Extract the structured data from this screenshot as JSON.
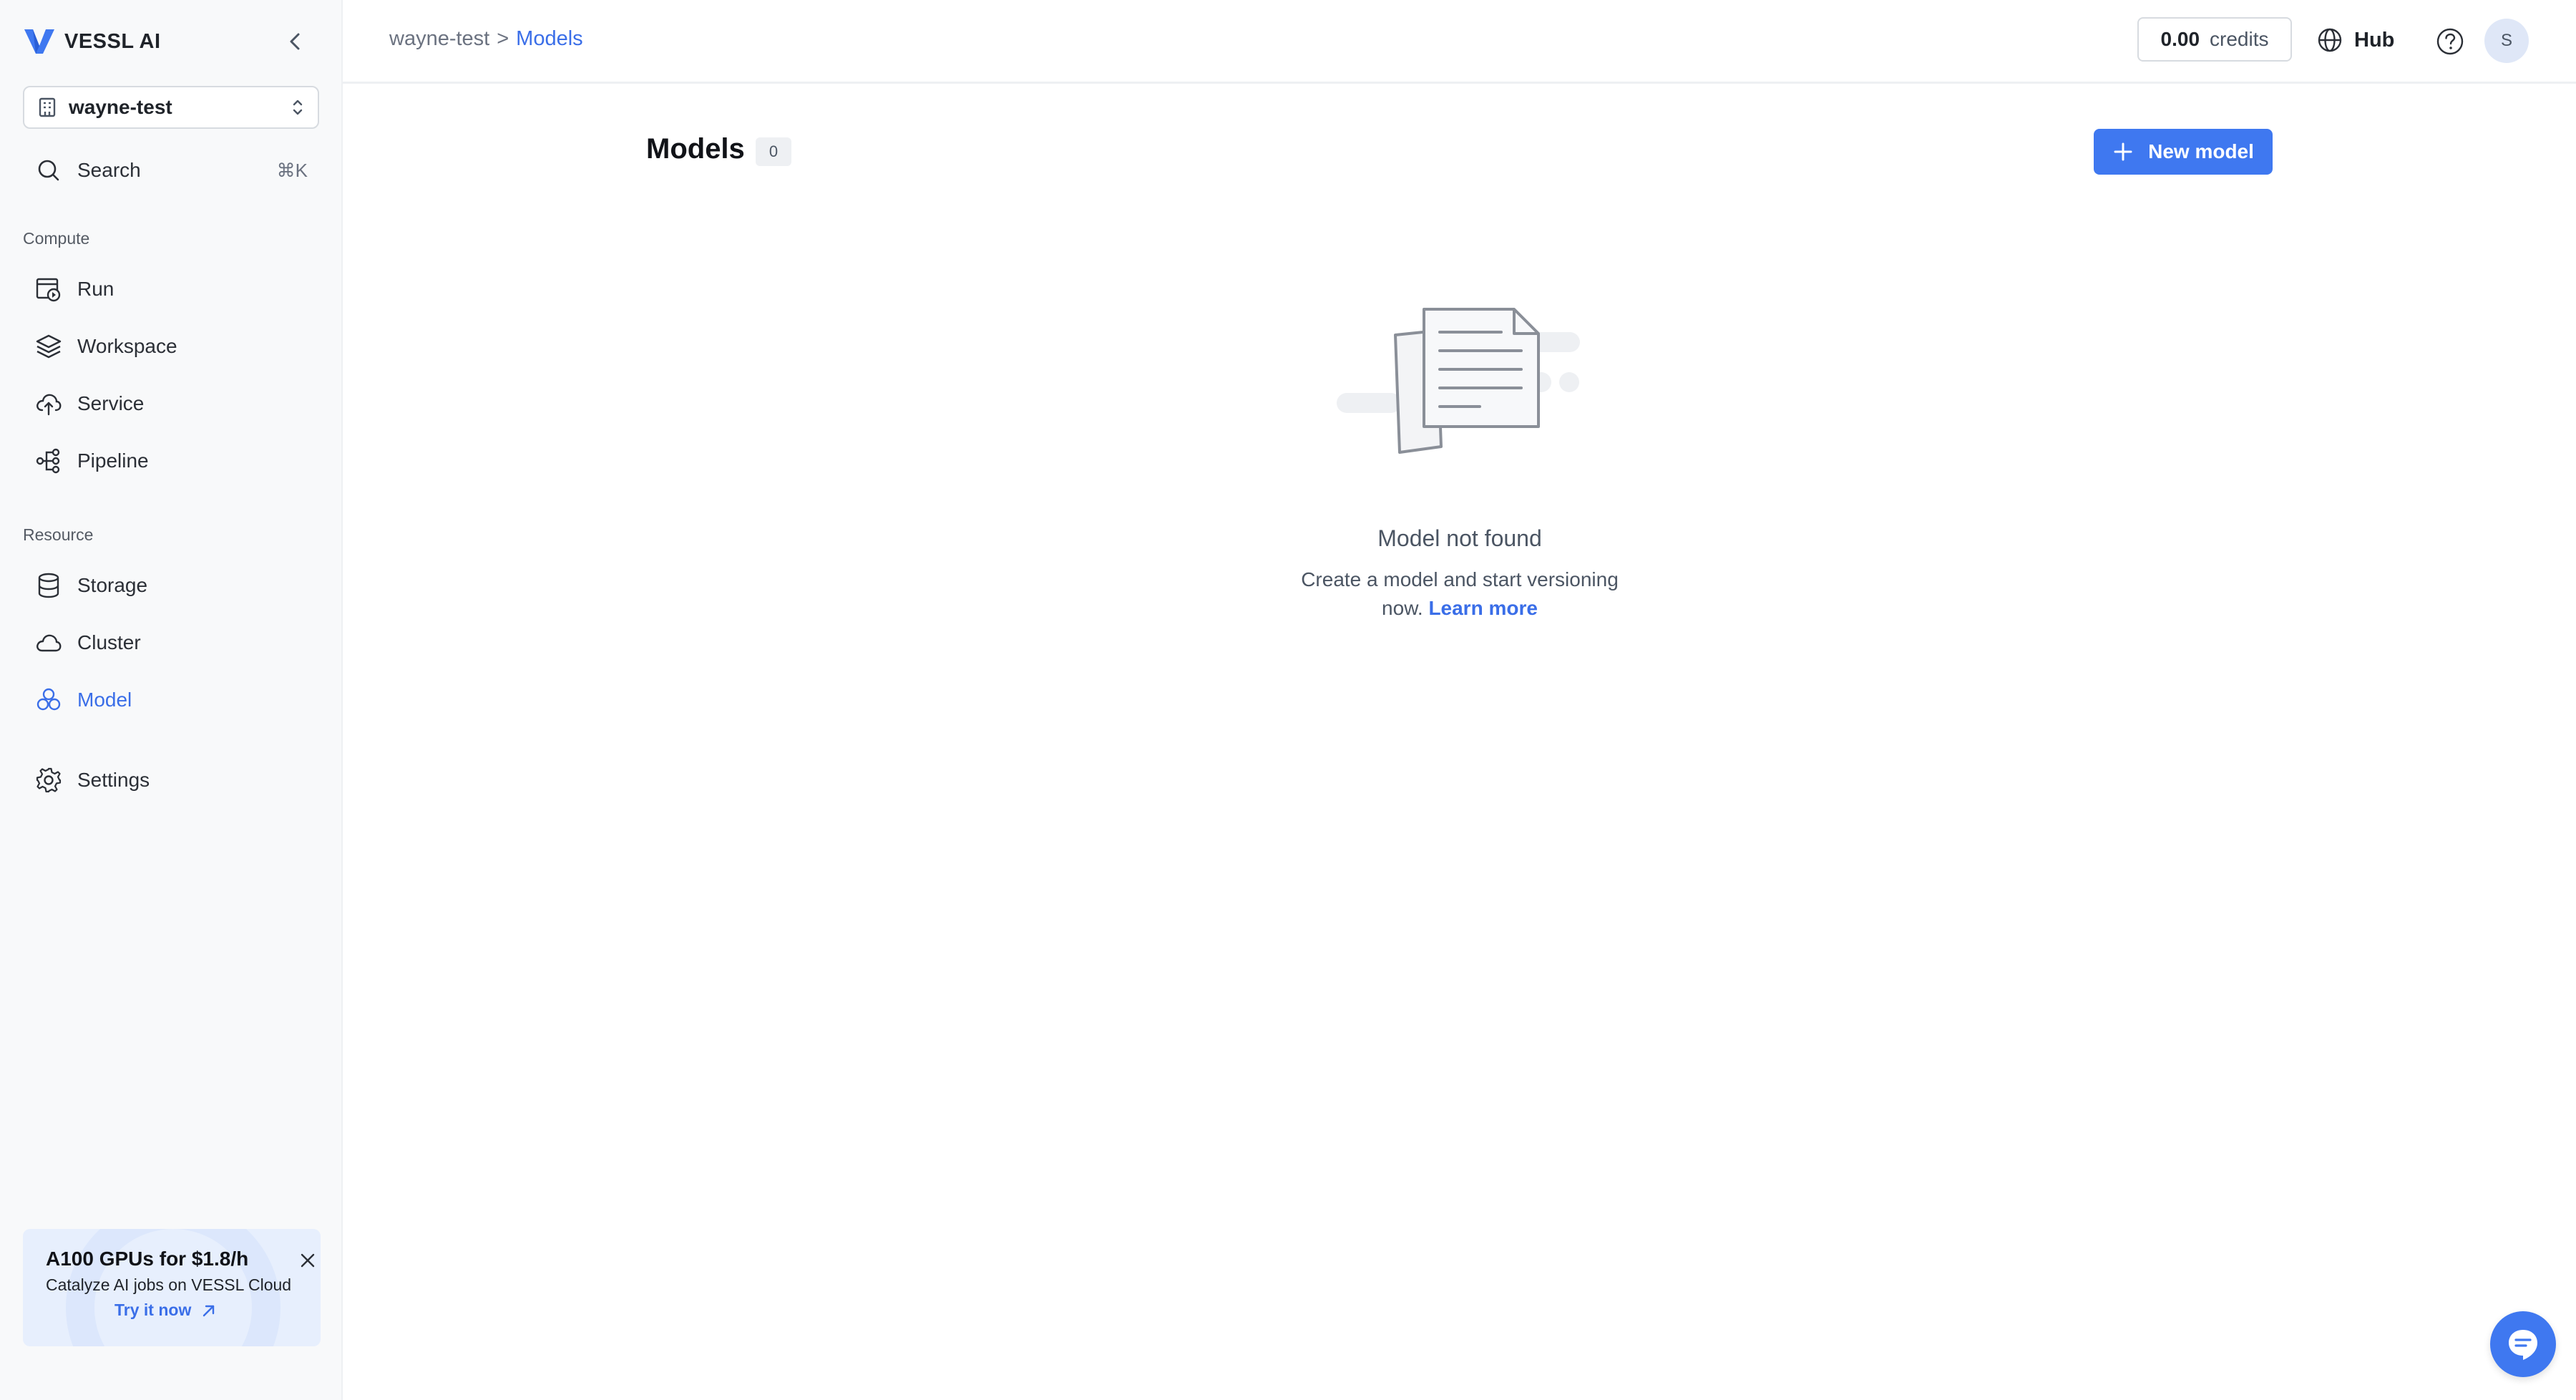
{
  "brand": {
    "name": "VESSL AI"
  },
  "sidebar": {
    "org": "wayne-test",
    "search": {
      "label": "Search",
      "shortcut": "⌘K"
    },
    "sections": {
      "compute": "Compute",
      "resource": "Resource"
    },
    "compute_items": [
      {
        "label": "Run",
        "icon": "run-icon"
      },
      {
        "label": "Workspace",
        "icon": "layers-icon"
      },
      {
        "label": "Service",
        "icon": "cloud-upload-icon"
      },
      {
        "label": "Pipeline",
        "icon": "pipeline-icon"
      }
    ],
    "resource_items": [
      {
        "label": "Storage",
        "icon": "database-icon"
      },
      {
        "label": "Cluster",
        "icon": "cloud-icon"
      },
      {
        "label": "Model",
        "icon": "model-icon",
        "active": true
      }
    ],
    "settings": {
      "label": "Settings",
      "icon": "gear-icon"
    },
    "promo": {
      "title": "A100 GPUs for $1.8/h",
      "subtitle": "Catalyze AI jobs on VESSL Cloud",
      "cta": "Try it now"
    }
  },
  "header": {
    "breadcrumb": {
      "org": "wayne-test",
      "separator": ">",
      "current": "Models"
    },
    "credits": {
      "amount": "0.00",
      "unit": "credits"
    },
    "hub_label": "Hub",
    "avatar_initial": "S"
  },
  "main": {
    "title": "Models",
    "count": "0",
    "new_button": "New model",
    "empty": {
      "title": "Model not found",
      "desc_line1": "Create a model and start versioning",
      "desc_line2": "now.",
      "link": "Learn more"
    }
  },
  "colors": {
    "accent": "#3f78f0",
    "link": "#3a6ee8",
    "sidebar_bg": "#f8f9fa",
    "promo_bg": "#e7effd"
  }
}
